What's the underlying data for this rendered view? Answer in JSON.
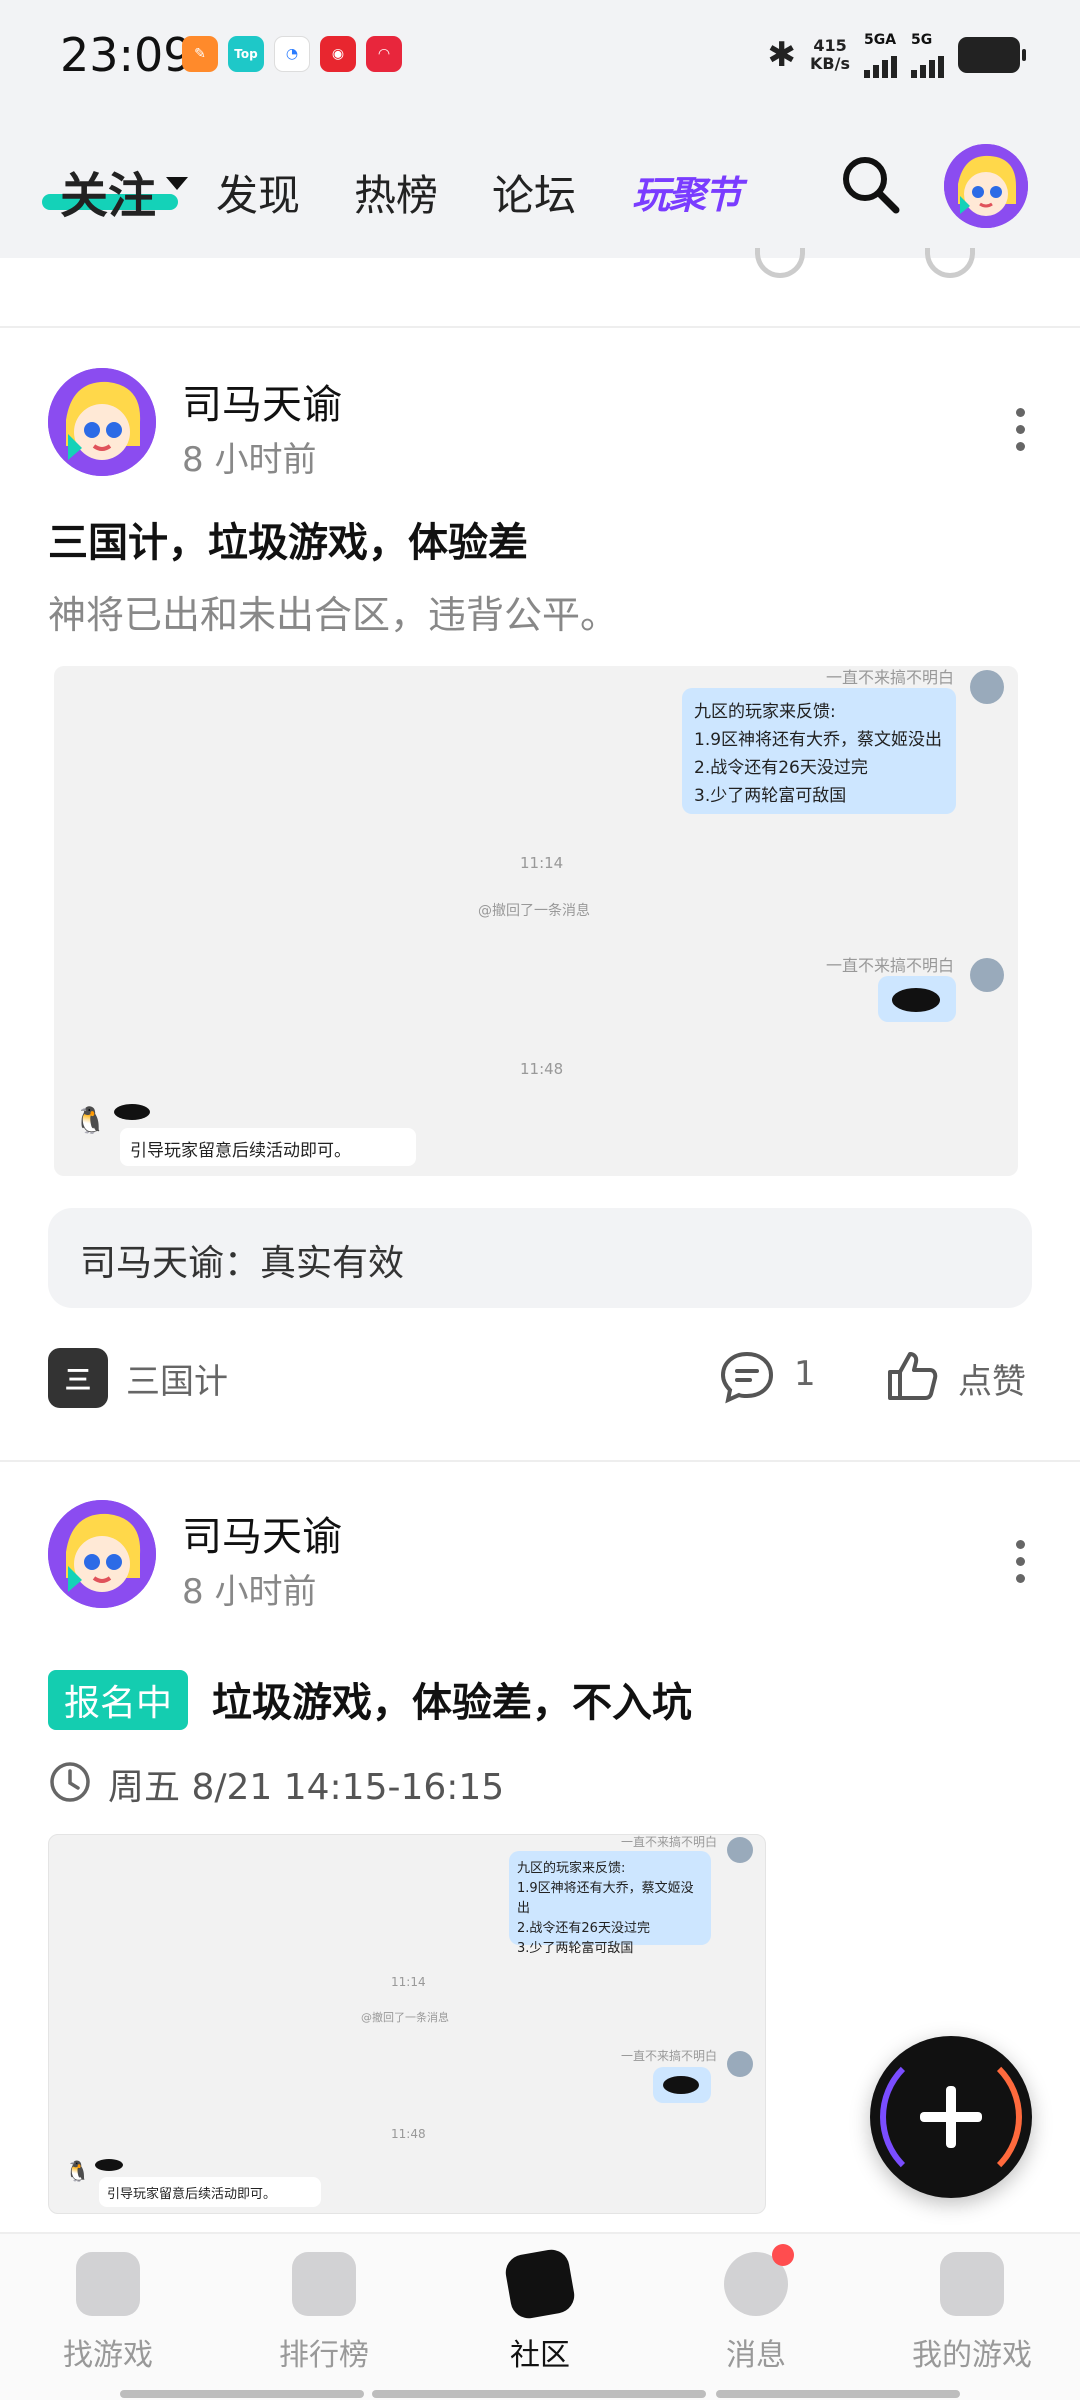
{
  "status_bar": {
    "time": "23:09",
    "net_speed": "415",
    "net_unit": "KB/s",
    "sim1": "5GA",
    "sim2": "5G",
    "app_icons": [
      {
        "name": "app-orange",
        "color": "#ff8a2b",
        "glyph": "✎"
      },
      {
        "name": "top-app",
        "color": "#1ec8c8",
        "glyph": "Top"
      },
      {
        "name": "circle-app",
        "color": "#ffffff",
        "glyph": "◔"
      },
      {
        "name": "netease-music",
        "color": "#e8262f",
        "glyph": "◉"
      },
      {
        "name": "red-app",
        "color": "#e8263c",
        "glyph": "◠"
      }
    ]
  },
  "top_nav": {
    "tabs": [
      "关注",
      "发现",
      "热榜",
      "论坛"
    ],
    "festival_label": "玩聚节",
    "accent_color": "#14d2b8"
  },
  "posts": [
    {
      "author": "司马天谕",
      "time": "8 小时前",
      "title": "三国计，垃圾游戏，体验差",
      "body": "神将已出和未出合区，违背公平。",
      "screenshot": {
        "who1": "一直不来搞不明白",
        "bubble": [
          "九区的玩家来反馈:",
          "1.9区神将还有大乔，蔡文姬没出",
          "2.战令还有26天没过完",
          "3.少了两轮富可敌国"
        ],
        "stamp1": "11:14",
        "recall": "@撤回了一条消息",
        "who2": "一直不来搞不明白",
        "stamp2": "11:48",
        "last_msg": "引导玩家留意后续活动即可。"
      },
      "comment_preview": "司马天谕：真实有效",
      "game": "三国计",
      "game_icon_text": "三",
      "comment_count": "1",
      "like_label": "点赞"
    },
    {
      "author": "司马天谕",
      "time": "8 小时前",
      "badge": "报名中",
      "title": "垃圾游戏，体验差，不入坑",
      "event_time": "周五 8/21 14:15-16:15",
      "screenshot": {
        "who1": "一直不来搞不明白",
        "bubble": [
          "九区的玩家来反馈:",
          "1.9区神将还有大乔，蔡文姬没出",
          "2.战令还有26天没过完",
          "3.少了两轮富可敌国"
        ],
        "stamp1": "11:14",
        "recall": "@撤回了一条消息",
        "who2": "一直不来搞不明白",
        "stamp2": "11:48",
        "last_msg": "引导玩家留意后续活动即可。"
      }
    }
  ],
  "bottom_nav": {
    "items": [
      "找游戏",
      "排行榜",
      "社区",
      "消息",
      "我的游戏"
    ],
    "active_index": 2
  }
}
